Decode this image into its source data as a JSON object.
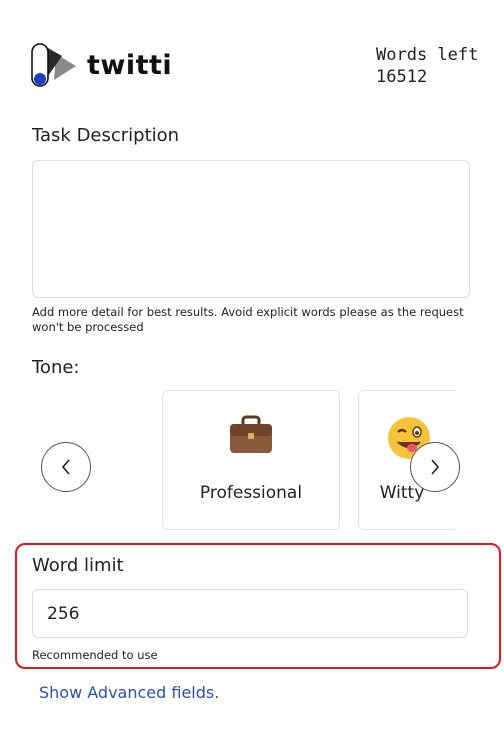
{
  "header": {
    "brand": "twitti",
    "words_left_label": "Words left",
    "words_left_value": "16512"
  },
  "task": {
    "label": "Task Description",
    "value": "",
    "help": "Add more detail for best results. Avoid explicit words please as the request won't be processed"
  },
  "tone": {
    "label": "Tone:",
    "options": [
      {
        "name": "Professional",
        "icon": "briefcase-icon"
      },
      {
        "name": "Witty",
        "icon": "winking-face-tongue-icon"
      }
    ]
  },
  "word_limit": {
    "label": "Word limit",
    "value": "256",
    "help": "Recommended to use"
  },
  "advanced_link": "Show Advanced fields.",
  "colors": {
    "highlight": "#e0191e",
    "link": "#2c50b5",
    "logo_dot": "#1f3fb8"
  }
}
